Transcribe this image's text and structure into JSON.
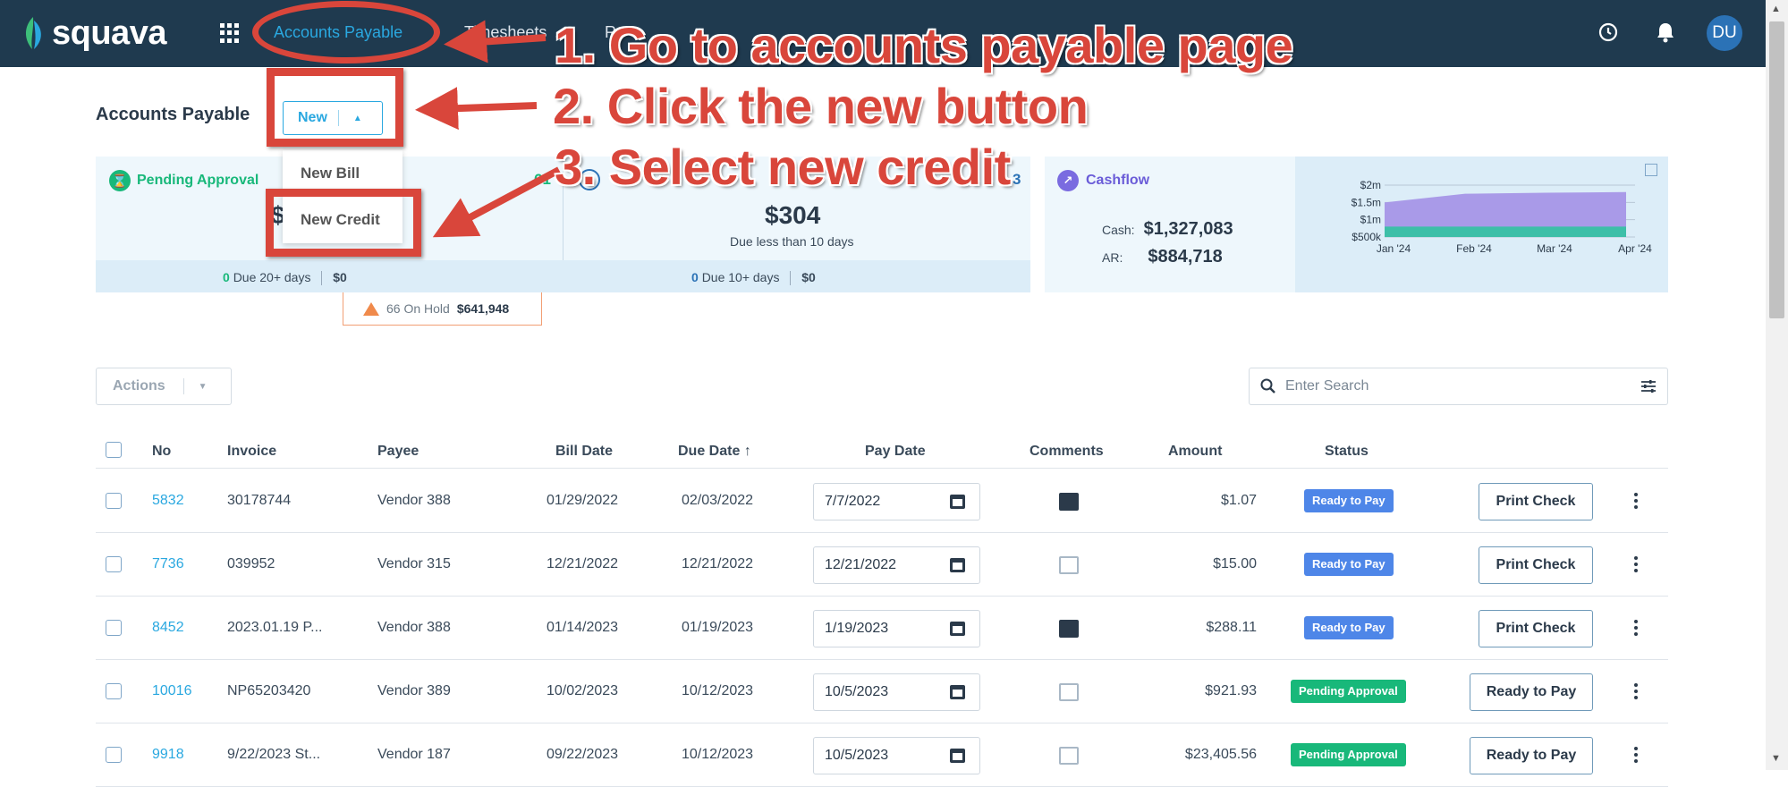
{
  "app": {
    "brand": "squava"
  },
  "nav": {
    "items": [
      {
        "label": "Accounts Payable",
        "active": true
      },
      {
        "label": "Timesheets",
        "active": false
      },
      {
        "label": "R",
        "active": false
      }
    ]
  },
  "header_icons": [
    "clock-icon",
    "bell-icon"
  ],
  "user": {
    "initials": "DU"
  },
  "page": {
    "title": "Accounts Payable"
  },
  "new_button": {
    "label": "New"
  },
  "new_menu": {
    "items": [
      "New Bill",
      "New Credit"
    ]
  },
  "pending": {
    "label": "Pending Approval",
    "count": "61",
    "amount_partial": "$",
    "bottom_count": "0",
    "bottom_text": "Due 20+ days",
    "bottom_amount": "$0"
  },
  "ready": {
    "count": "3",
    "amount": "$304",
    "subtext": "Due less than 10 days",
    "bottom_count": "0",
    "bottom_text": "Due 10+ days",
    "bottom_amount": "$0"
  },
  "on_hold": {
    "count_text": "66 On Hold",
    "amount": "$641,948"
  },
  "cashflow": {
    "label": "Cashflow",
    "cash_label": "Cash:",
    "cash_value": "$1,327,083",
    "ar_label": "AR:",
    "ar_value": "$884,718"
  },
  "chart_data": {
    "type": "area",
    "x": [
      "Jan '24",
      "Feb '24",
      "Mar '24",
      "Apr '24"
    ],
    "ytick_labels": [
      "$2m",
      "$1.5m",
      "$1m",
      "$500k"
    ],
    "series": [
      {
        "values": [
          1.5,
          1.75,
          1.78,
          1.8
        ],
        "color": "#a99ae8"
      },
      {
        "values": [
          0.8,
          0.8,
          0.8,
          0.8
        ],
        "color": "#3dbfa8"
      }
    ],
    "ylim": [
      0.5,
      2
    ]
  },
  "toolbar": {
    "actions_label": "Actions",
    "search_placeholder": "Enter Search"
  },
  "table": {
    "headers": [
      "No",
      "Invoice",
      "Payee",
      "Bill Date",
      "Due Date",
      "Pay Date",
      "Comments",
      "Amount",
      "Status"
    ],
    "sort_indicator": "↑",
    "rows": [
      {
        "no": "5832",
        "invoice": "30178744",
        "payee": "Vendor 388",
        "bill_date": "01/29/2022",
        "due_date": "02/03/2022",
        "pay_date": "7/7/2022",
        "comment": "dark",
        "amount": "$1.07",
        "status": "Ready to Pay",
        "status_color": "#4e86e8",
        "action": "Print Check"
      },
      {
        "no": "7736",
        "invoice": "039952",
        "payee": "Vendor 315",
        "bill_date": "12/21/2022",
        "due_date": "12/21/2022",
        "pay_date": "12/21/2022",
        "comment": "light",
        "amount": "$15.00",
        "status": "Ready to Pay",
        "status_color": "#4e86e8",
        "action": "Print Check"
      },
      {
        "no": "8452",
        "invoice": "2023.01.19 P...",
        "payee": "Vendor 388",
        "bill_date": "01/14/2023",
        "due_date": "01/19/2023",
        "pay_date": "1/19/2023",
        "comment": "dark",
        "amount": "$288.11",
        "status": "Ready to Pay",
        "status_color": "#4e86e8",
        "action": "Print Check"
      },
      {
        "no": "10016",
        "invoice": "NP65203420",
        "payee": "Vendor 389",
        "bill_date": "10/02/2023",
        "due_date": "10/12/2023",
        "pay_date": "10/5/2023",
        "comment": "light",
        "amount": "$921.93",
        "status": "Pending Approval",
        "status_color": "#18b87a",
        "action": "Ready to Pay"
      },
      {
        "no": "9918",
        "invoice": "9/22/2023 St...",
        "payee": "Vendor 187",
        "bill_date": "09/22/2023",
        "due_date": "10/12/2023",
        "pay_date": "10/5/2023",
        "comment": "light",
        "amount": "$23,405.56",
        "status": "Pending Approval",
        "status_color": "#18b87a",
        "action": "Ready to Pay"
      }
    ]
  },
  "annotations": {
    "step1": "1. Go to accounts payable page",
    "step2": "2. Click the new button",
    "step3": "3. Select new credit"
  },
  "colors": {
    "topbar": "#1f3a4f",
    "accent": "#2aa8e0",
    "annotation": "#d9463b",
    "green": "#18b87a"
  }
}
